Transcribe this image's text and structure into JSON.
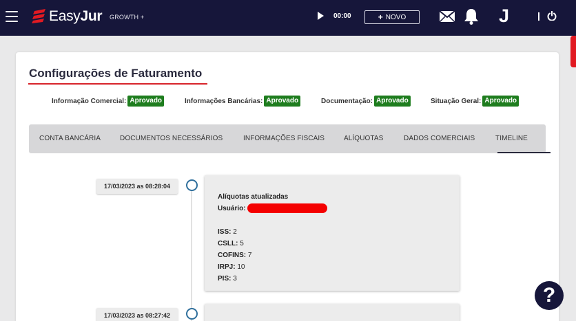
{
  "topbar": {
    "brand_light": "Easy",
    "brand_bold": "Jur",
    "plan": "GROWTH +",
    "timer": "00:00",
    "new_button": "NOVO",
    "user_initial": "J",
    "icons": [
      "menu-icon",
      "logo-icon",
      "play-icon",
      "plus-icon",
      "mail-icon",
      "bell-icon",
      "power-icon"
    ]
  },
  "page": {
    "title": "Configurações de Faturamento"
  },
  "status": [
    {
      "label": "Informação Comercial:",
      "value": "Aprovado"
    },
    {
      "label": "Informações Bancárias:",
      "value": "Aprovado"
    },
    {
      "label": "Documentação:",
      "value": "Aprovado"
    },
    {
      "label": "Situação Geral:",
      "value": "Aprovado"
    }
  ],
  "tabs": [
    {
      "label": "CONTA BANCÁRIA"
    },
    {
      "label": "DOCUMENTOS NECESSÁRIOS"
    },
    {
      "label": "INFORMAÇÕES FISCAIS"
    },
    {
      "label": "ALÍQUOTAS"
    },
    {
      "label": "DADOS COMERCIAIS"
    },
    {
      "label": "TIMELINE",
      "active": true
    }
  ],
  "timeline": [
    {
      "timestamp": "17/03/2023 as 08:28:04",
      "title": "Alíquotas atualizadas",
      "user_label": "Usuário:",
      "items": [
        {
          "k": "ISS:",
          "v": "2"
        },
        {
          "k": "CSLL:",
          "v": "5"
        },
        {
          "k": "COFINS:",
          "v": "7"
        },
        {
          "k": "IRPJ:",
          "v": "10"
        },
        {
          "k": "PIS:",
          "v": "3"
        }
      ]
    },
    {
      "timestamp": "17/03/2023 as 08:27:42"
    }
  ],
  "help": {
    "label": "?"
  },
  "colors": {
    "topbar": "#16163a",
    "accent_red": "#d8232a",
    "approved": "#1e7d1e",
    "timeline_dot": "#2f6f9c"
  }
}
